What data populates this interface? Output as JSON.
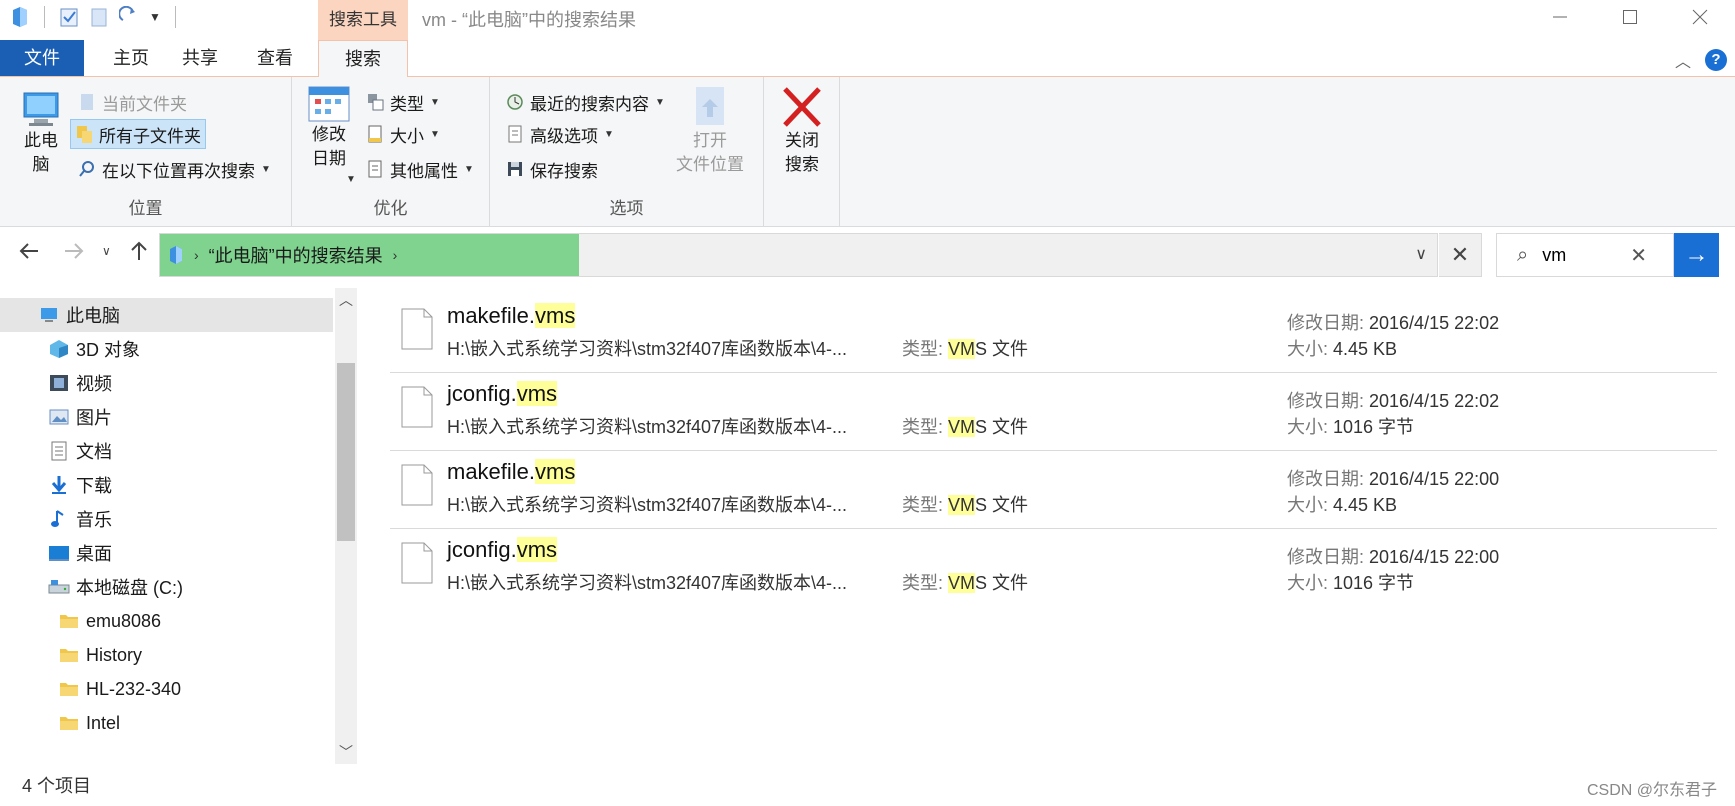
{
  "window": {
    "context_tab_title": "搜索工具",
    "title": "vm - “此电脑”中的搜索结果",
    "controls": [
      "minimize",
      "maximize",
      "close"
    ]
  },
  "tabs": [
    {
      "label": "文件"
    },
    {
      "label": "主页"
    },
    {
      "label": "共享"
    },
    {
      "label": "查看"
    },
    {
      "label": "搜索"
    }
  ],
  "ribbon": {
    "location": {
      "label": "位置",
      "this_pc": "此电\n脑",
      "current_folder": "当前文件夹",
      "all_subfolders": "所有子文件夹",
      "search_again": "在以下位置再次搜索"
    },
    "refine": {
      "label": "优化",
      "date_modified": "修改\n日期",
      "kind": "类型",
      "size": "大小",
      "other_props": "其他属性"
    },
    "options": {
      "label": "选项",
      "recent_searches": "最近的搜索内容",
      "advanced": "高级选项",
      "save_search": "保存搜索",
      "open_location": "打开\n文件位置"
    },
    "close": {
      "label": "关闭\n搜索"
    }
  },
  "address": {
    "crumb": "“此电脑”中的搜索结果"
  },
  "search": {
    "value": "vm"
  },
  "nav": {
    "items": [
      {
        "label": "此电脑",
        "icon": "computer-icon",
        "selected": true
      },
      {
        "label": "3D 对象",
        "icon": "3d-objects-icon"
      },
      {
        "label": "视频",
        "icon": "video-icon"
      },
      {
        "label": "图片",
        "icon": "pictures-icon"
      },
      {
        "label": "文档",
        "icon": "documents-icon"
      },
      {
        "label": "下载",
        "icon": "download-icon"
      },
      {
        "label": "音乐",
        "icon": "music-icon"
      },
      {
        "label": "桌面",
        "icon": "desktop-icon"
      },
      {
        "label": "本地磁盘 (C:)",
        "icon": "drive-icon"
      },
      {
        "label": "emu8086",
        "icon": "folder-icon"
      },
      {
        "label": "History",
        "icon": "folder-icon"
      },
      {
        "label": "HL-232-340",
        "icon": "folder-icon"
      },
      {
        "label": "Intel",
        "icon": "folder-icon"
      }
    ]
  },
  "results": [
    {
      "name_pre": "makefile.",
      "name_hl": "vms",
      "path": "H:\\嵌入式系统学习资料\\stm32f407库函数版本\\4-...",
      "type_label": "类型: ",
      "type_hl": "VM",
      "type_rest": "S 文件",
      "date_label": "修改日期: ",
      "date": "2016/4/15 22:02",
      "size_label": "大小: ",
      "size": "4.45 KB"
    },
    {
      "name_pre": "jconfig.",
      "name_hl": "vms",
      "path": "H:\\嵌入式系统学习资料\\stm32f407库函数版本\\4-...",
      "type_label": "类型: ",
      "type_hl": "VM",
      "type_rest": "S 文件",
      "date_label": "修改日期: ",
      "date": "2016/4/15 22:02",
      "size_label": "大小: ",
      "size": "1016 字节"
    },
    {
      "name_pre": "makefile.",
      "name_hl": "vms",
      "path": "H:\\嵌入式系统学习资料\\stm32f407库函数版本\\4-...",
      "type_label": "类型: ",
      "type_hl": "VM",
      "type_rest": "S 文件",
      "date_label": "修改日期: ",
      "date": "2016/4/15 22:00",
      "size_label": "大小: ",
      "size": "4.45 KB"
    },
    {
      "name_pre": "jconfig.",
      "name_hl": "vms",
      "path": "H:\\嵌入式系统学习资料\\stm32f407库函数版本\\4-...",
      "type_label": "类型: ",
      "type_hl": "VM",
      "type_rest": "S 文件",
      "date_label": "修改日期: ",
      "date": "2016/4/15 22:00",
      "size_label": "大小: ",
      "size": "1016 字节"
    }
  ],
  "status": {
    "count": "4 个项目",
    "watermark": "CSDN @尔东君子"
  },
  "colors": {
    "file_tab": "#1a5fb4",
    "context_tab": "#fbd5c0",
    "address_crumb": "#7fd38f",
    "search_go": "#1a6fd4",
    "highlight": "#ffff99",
    "close_search_x": "#d42020"
  }
}
